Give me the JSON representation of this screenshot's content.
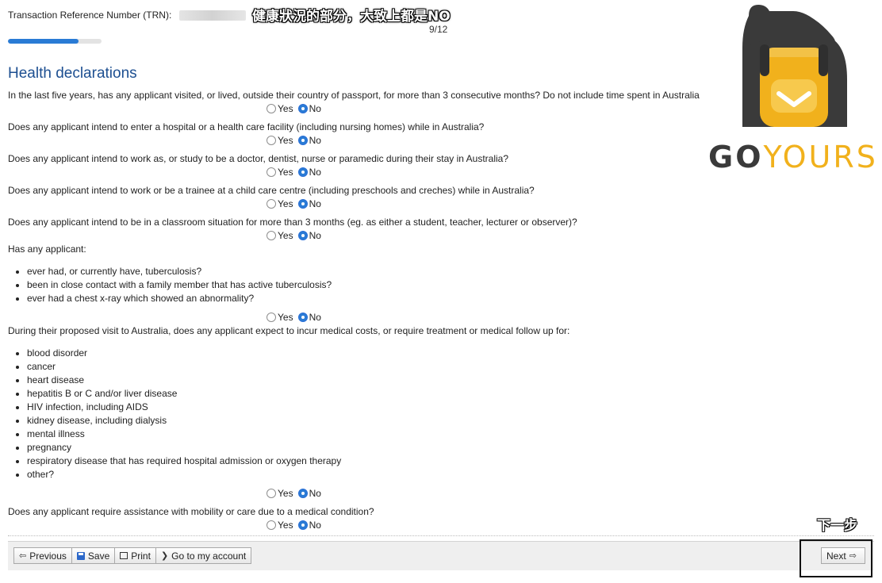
{
  "header": {
    "trn_label": "Transaction Reference Number (TRN):",
    "page_counter": "9/12",
    "progress_fraction": 0.75
  },
  "annotations": {
    "top": "健康狀況的部分，大致上都是NO",
    "next_hint": "下一步"
  },
  "logo": {
    "text_go": "GO",
    "text_yours": "YOURS",
    "brand_dark": "#3a3a3a",
    "brand_yellow": "#f1b11c"
  },
  "section": {
    "title": "Health declarations"
  },
  "radio": {
    "yes": "Yes",
    "no": "No"
  },
  "questions": [
    {
      "text": "In the last five years, has any applicant visited, or lived, outside their country of passport, for more than 3 consecutive months? Do not include time spent in Australia",
      "answer": "No"
    },
    {
      "text": "Does any applicant intend to enter a hospital or a health care facility (including nursing homes) while in Australia?",
      "answer": "No"
    },
    {
      "text": "Does any applicant intend to work as, or study to be a doctor, dentist, nurse or paramedic during their stay in Australia?",
      "answer": "No"
    },
    {
      "text": "Does any applicant intend to work or be a trainee at a child care centre (including preschools and creches) while in Australia?",
      "answer": "No"
    },
    {
      "text": "Does any applicant intend to be in a classroom situation for more than 3 months (eg. as either a student, teacher, lecturer or observer)?",
      "answer": "No"
    },
    {
      "text": "Has any applicant:",
      "bullets": [
        "ever had, or currently have, tuberculosis?",
        "been in close contact with a family member that has active tuberculosis?",
        "ever had a chest x-ray which showed an abnormality?"
      ],
      "answer": "No"
    },
    {
      "text": "During their proposed visit to Australia, does any applicant expect to incur medical costs, or require treatment or medical follow up for:",
      "bullets": [
        "blood disorder",
        "cancer",
        "heart disease",
        "hepatitis B or C and/or liver disease",
        "HIV infection, including AIDS",
        "kidney disease, including dialysis",
        "mental illness",
        "pregnancy",
        "respiratory disease that has required hospital admission or oxygen therapy",
        "other?"
      ],
      "answer": "No"
    },
    {
      "text": "Does any applicant require assistance with mobility or care due to a medical condition?",
      "answer": "No"
    }
  ],
  "footer": {
    "previous": "Previous",
    "save": "Save",
    "print": "Print",
    "account": "Go to my account",
    "next": "Next"
  }
}
